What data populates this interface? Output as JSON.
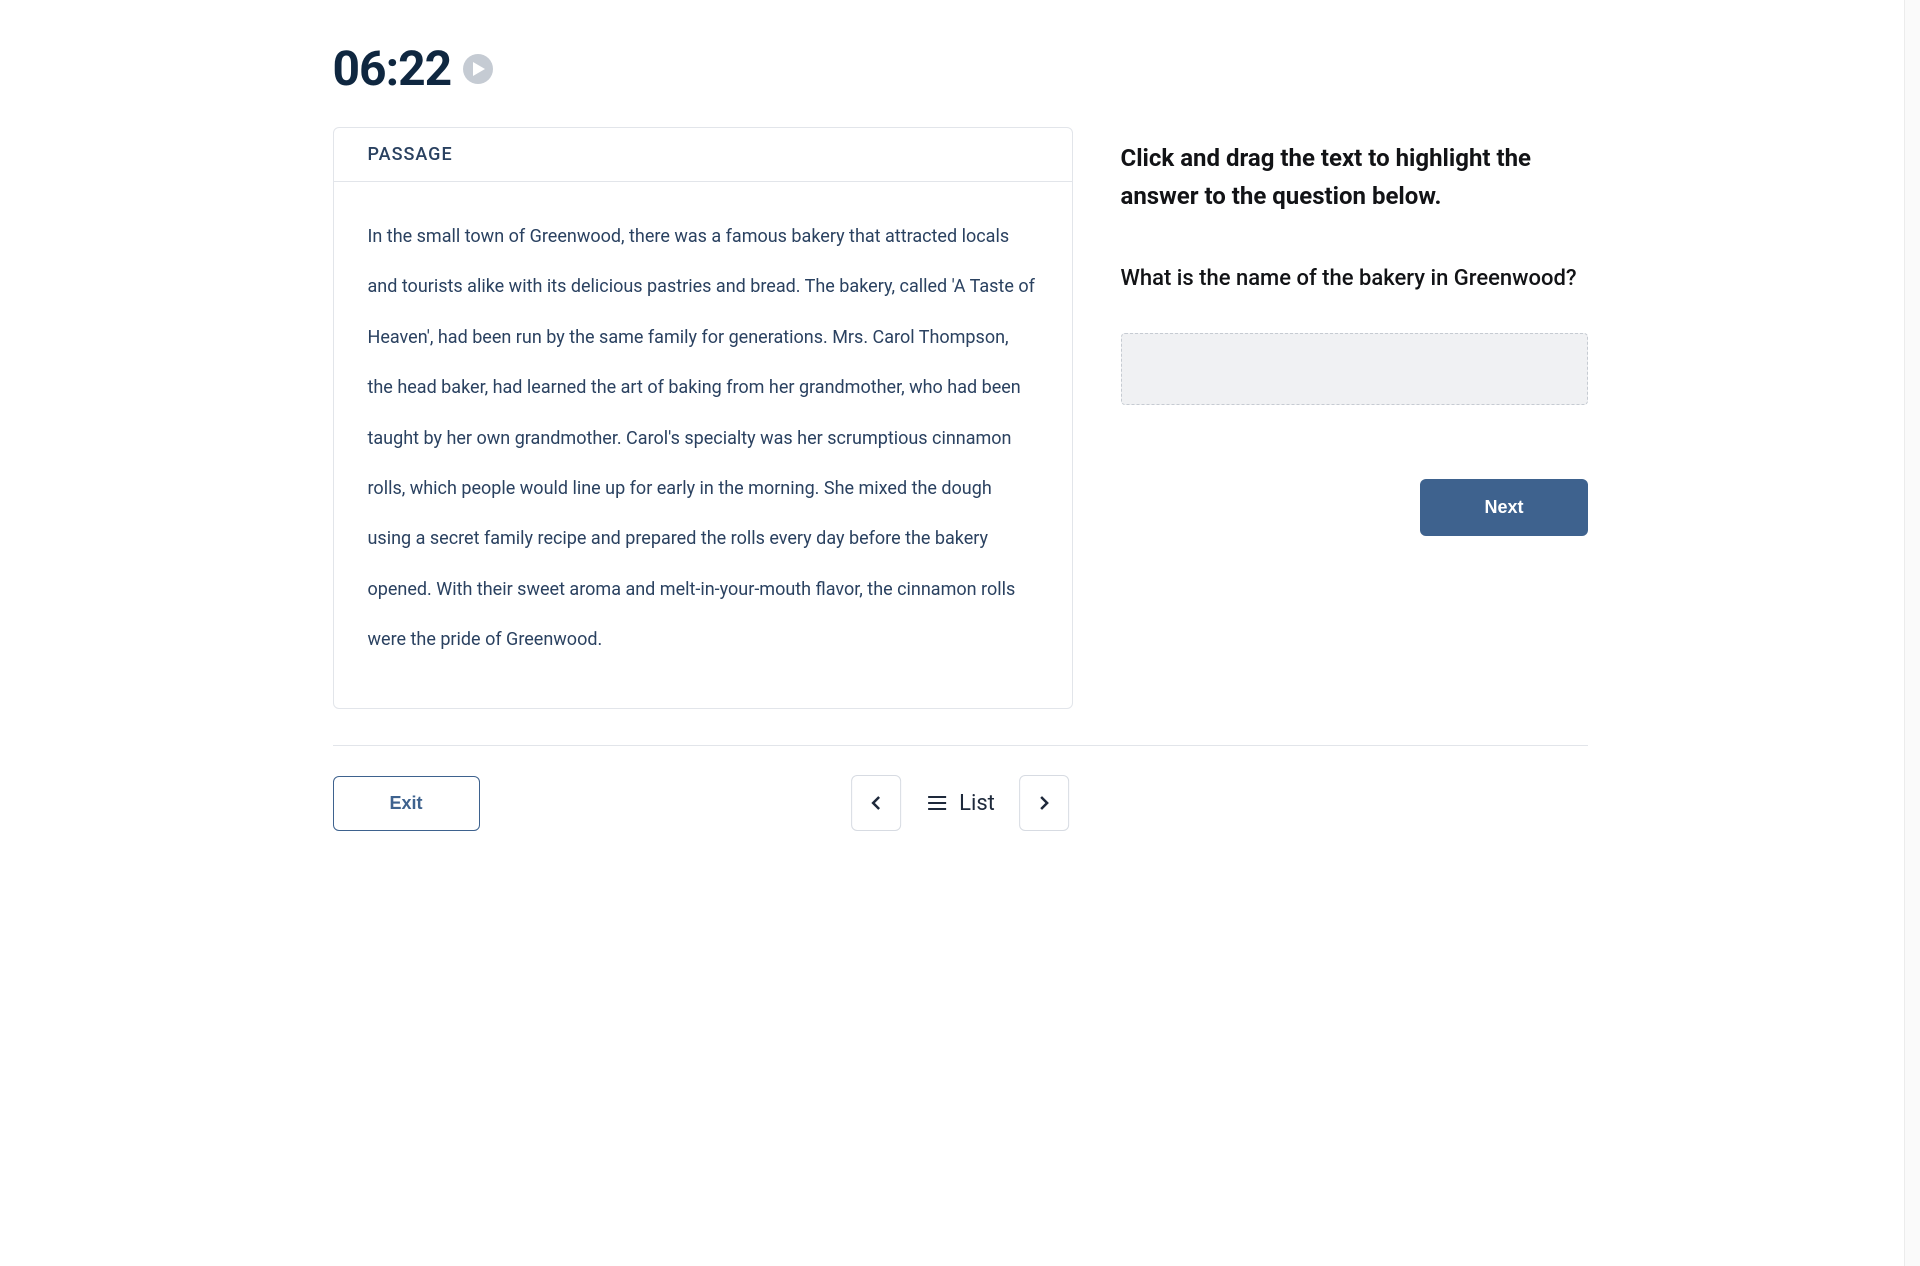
{
  "timer": "06:22",
  "passage": {
    "label": "PASSAGE",
    "body": "In the small town of Greenwood, there was a famous bakery that attracted locals and tourists alike with its delicious pastries and bread. The bakery, called 'A Taste of Heaven', had been run by the same family for generations. Mrs. Carol Thompson, the head baker, had learned the art of baking from her grandmother, who had been taught by her own grandmother. Carol's specialty was her scrumptious cinnamon rolls, which people would line up for early in the morning. She mixed the dough using a secret family recipe and prepared the rolls every day before the bakery opened. With their sweet aroma and melt-in-your-mouth flavor, the cinnamon rolls were the pride of Greenwood."
  },
  "instruction": "Click and drag the text to highlight the answer to the question below.",
  "question": "What is the name of the bakery in Greenwood?",
  "buttons": {
    "next": "Next",
    "exit": "Exit",
    "list": "List"
  }
}
